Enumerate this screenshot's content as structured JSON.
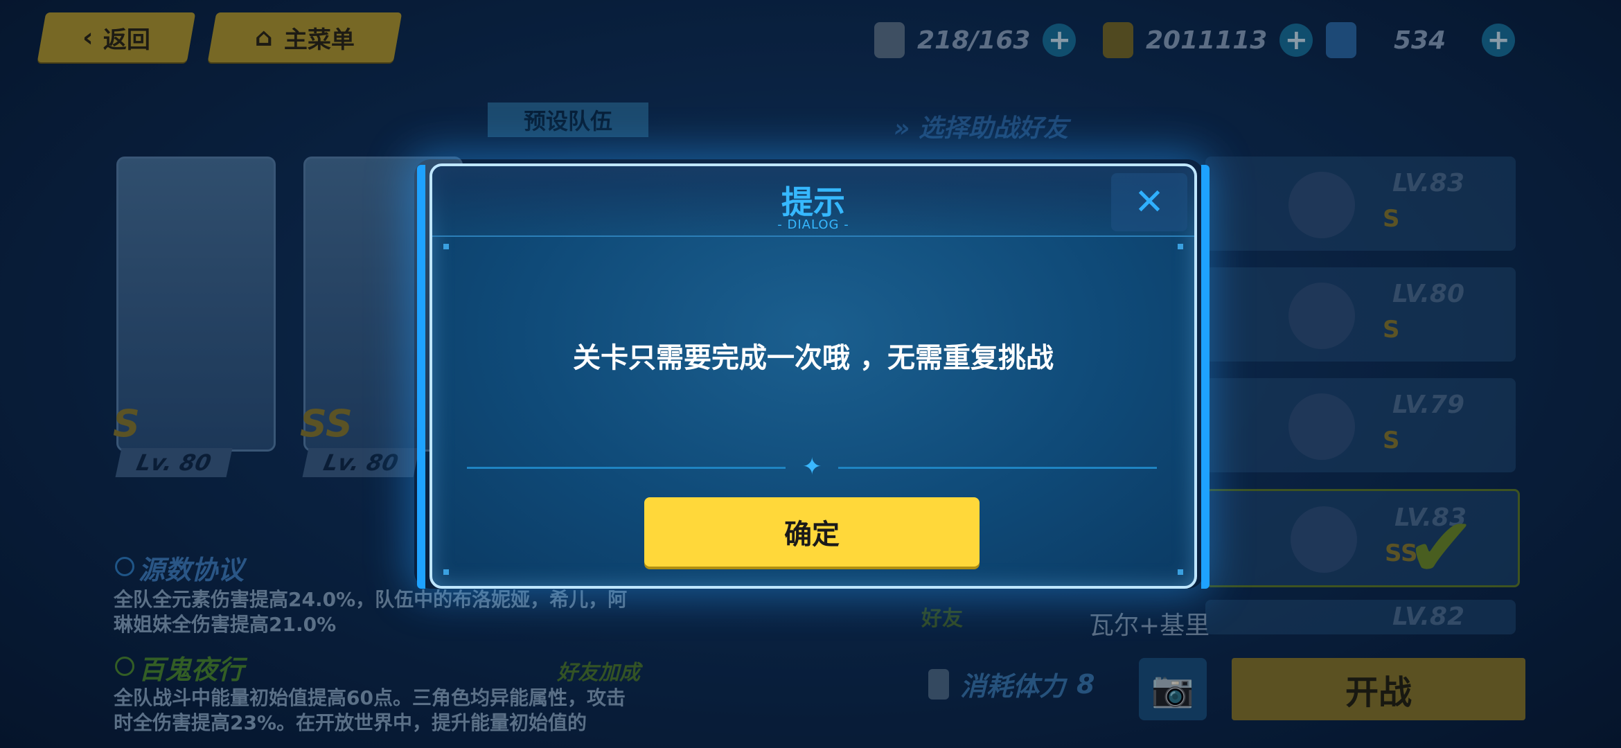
{
  "top_bar": {
    "back_label": "返回",
    "menu_label": "主菜单",
    "stamina": "218/163",
    "coins": "2011113",
    "crystals": "534"
  },
  "background": {
    "preset_team_tab": "预设队伍",
    "assist_title": "选择助战好友",
    "team_cards": [
      {
        "level": "Lv. 80",
        "rank": "S"
      },
      {
        "level": "Lv. 80",
        "rank": "SS"
      }
    ],
    "friends": [
      {
        "level": "LV.83",
        "rank": "S"
      },
      {
        "level": "LV.80",
        "rank": "S"
      },
      {
        "level": "LV.79",
        "rank": "S"
      },
      {
        "level": "LV.83",
        "rank": "SS"
      },
      {
        "level": "LV.82",
        "name": "瓦尔+基里",
        "tag": "好友"
      }
    ],
    "buffs": [
      {
        "name": "源数协议",
        "desc": "全队全元素伤害提高24.0%，队伍中的布洛妮娅，希儿，阿琳姐妹全伤害提高21.0%"
      },
      {
        "name": "百鬼夜行",
        "tag": "好友加成",
        "desc": "全队战斗中能量初始值提高60点。三角色均异能属性，攻击时全伤害提高23%。在开放世界中，提升能量初始值的"
      }
    ],
    "stamina_cost_label": "消耗体力",
    "stamina_cost_value": "8",
    "start_label": "开战"
  },
  "dialog": {
    "title": "提示",
    "subtitle": "- DIALOG -",
    "message": "关卡只需要完成一次哦 ，无需重复挑战",
    "confirm_label": "确定",
    "close_icon": "close-icon"
  },
  "colors": {
    "accent_blue": "#36b8ff",
    "confirm_yellow": "#ffd83a",
    "dialog_border": "#bfe6ff"
  }
}
